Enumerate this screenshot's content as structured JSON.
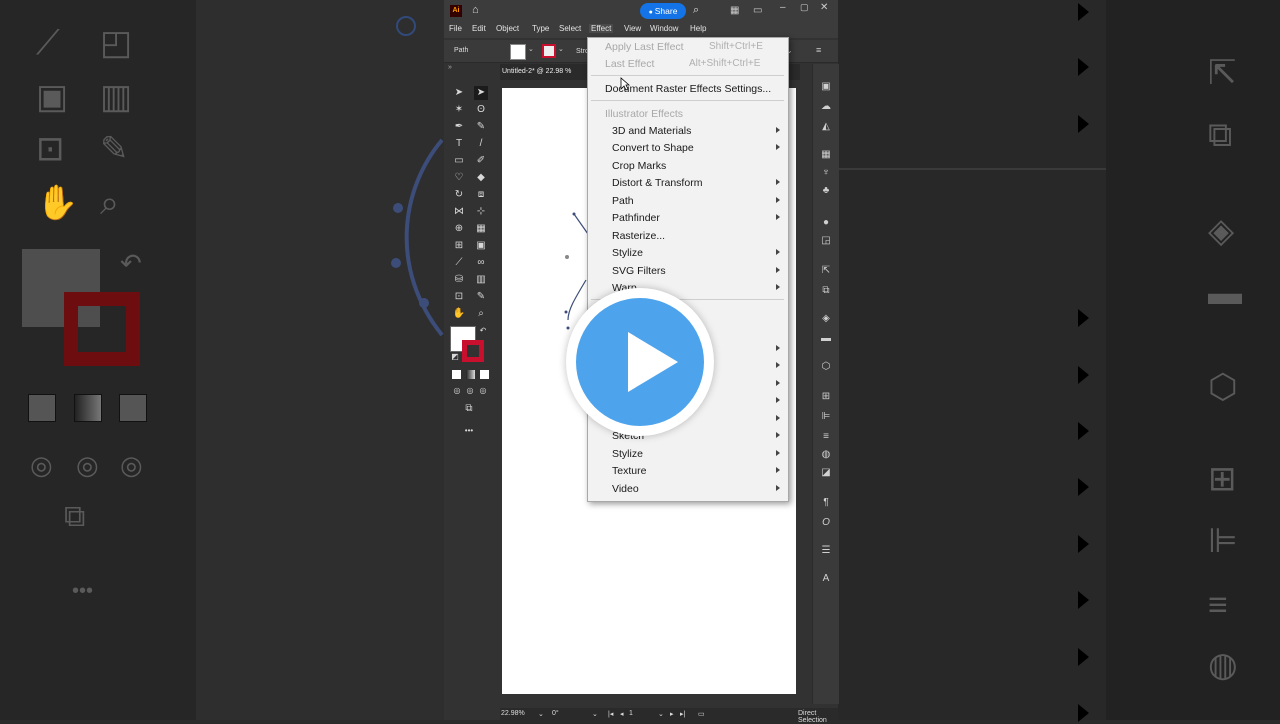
{
  "app": {
    "logo": "Ai",
    "share_label": "Share",
    "menus": [
      "File",
      "Edit",
      "Object",
      "Type",
      "Select",
      "Effect",
      "View",
      "Window",
      "Help"
    ],
    "active_menu": "Effect",
    "control_bar": {
      "selection_label": "Path",
      "stroke_label": "Stro"
    },
    "doc_tab": "Untitled-2* @ 22.98 %",
    "status": {
      "zoom": "22.98%",
      "rotation": "0°",
      "artboard": "1",
      "tool": "Direct Selection"
    }
  },
  "effect_menu": {
    "apply_last": {
      "label": "Apply Last Effect",
      "shortcut": "Shift+Ctrl+E"
    },
    "last_effect": {
      "label": "Last Effect",
      "shortcut": "Alt+Shift+Ctrl+E"
    },
    "raster_settings": "Document Raster Effects Settings...",
    "illustrator_header": "Illustrator Effects",
    "illustrator_items": [
      {
        "label": "3D and Materials",
        "submenu": true
      },
      {
        "label": "Convert to Shape",
        "submenu": true
      },
      {
        "label": "Crop Marks",
        "submenu": false
      },
      {
        "label": "Distort & Transform",
        "submenu": true
      },
      {
        "label": "Path",
        "submenu": true
      },
      {
        "label": "Pathfinder",
        "submenu": true
      },
      {
        "label": "Rasterize...",
        "submenu": false
      },
      {
        "label": "Stylize",
        "submenu": true
      },
      {
        "label": "SVG Filters",
        "submenu": true
      },
      {
        "label": "Warp",
        "submenu": true
      }
    ],
    "photoshop_items": [
      {
        "label": "Sketch",
        "submenu": true
      },
      {
        "label": "Stylize",
        "submenu": true
      },
      {
        "label": "Texture",
        "submenu": true
      },
      {
        "label": "Video",
        "submenu": true
      }
    ]
  },
  "colors": {
    "accent": "#1473e6",
    "play": "#4ea4ec",
    "stroke_red": "#c8102e"
  }
}
